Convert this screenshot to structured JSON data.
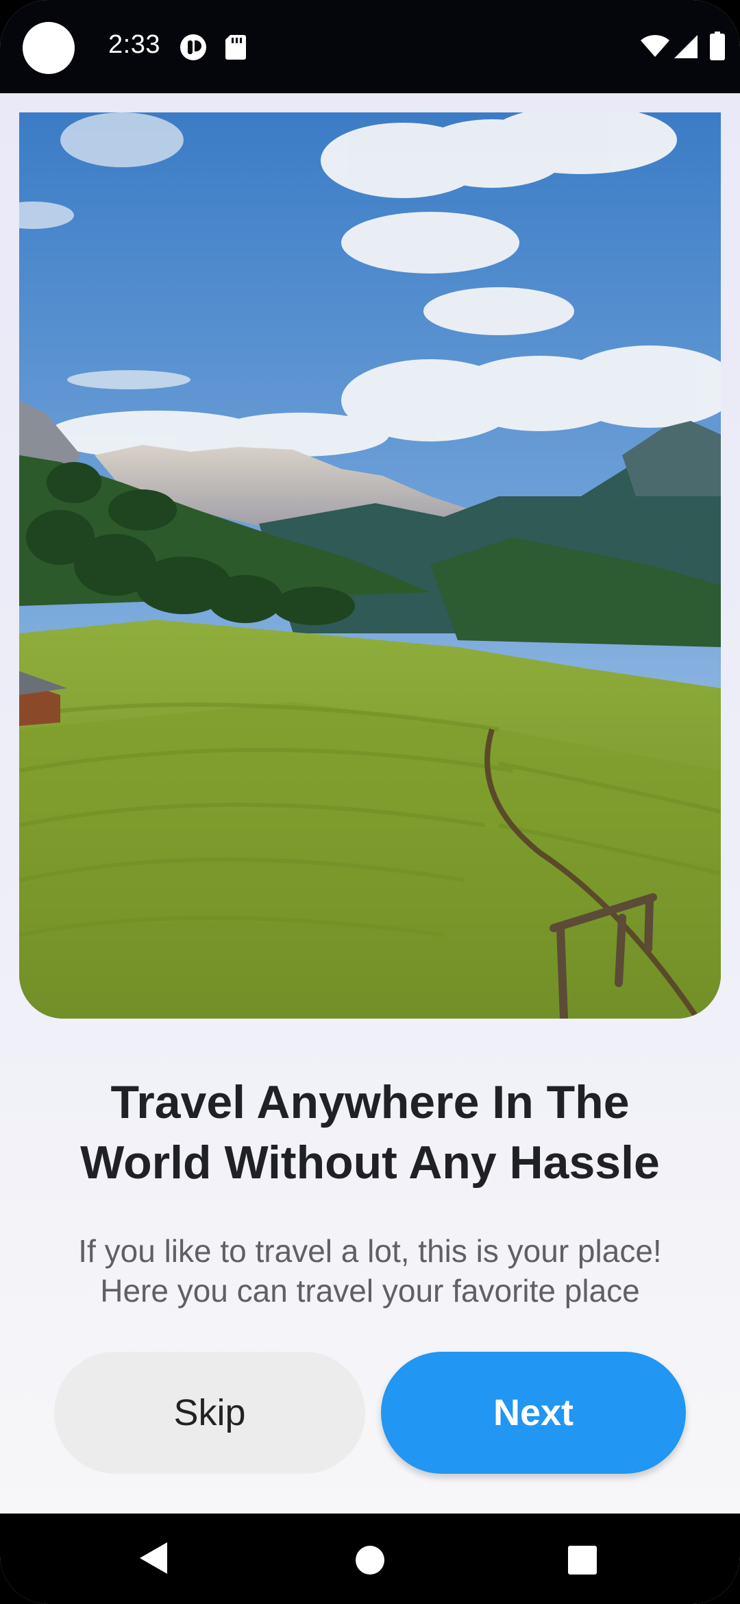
{
  "status_bar": {
    "time": "2:33",
    "icons": [
      "camera-cutout",
      "notification-icon",
      "sd-card-icon",
      "wifi-icon",
      "cell-signal-icon",
      "battery-icon"
    ]
  },
  "onboarding": {
    "image_subject": "mountain-meadow-landscape",
    "title": "Travel Anywhere In The\nWorld Without Any Hassle",
    "description": "If you like to travel a lot, this is your place!\nHere you can travel your favorite place",
    "skip_label": "Skip",
    "next_label": "Next"
  },
  "nav_bar": {
    "icons": [
      "back-icon",
      "home-icon",
      "recents-icon"
    ]
  },
  "colors": {
    "primary": "#2196f3",
    "skip_bg": "#ececec",
    "title": "#202124",
    "body_text": "#5f6063"
  }
}
